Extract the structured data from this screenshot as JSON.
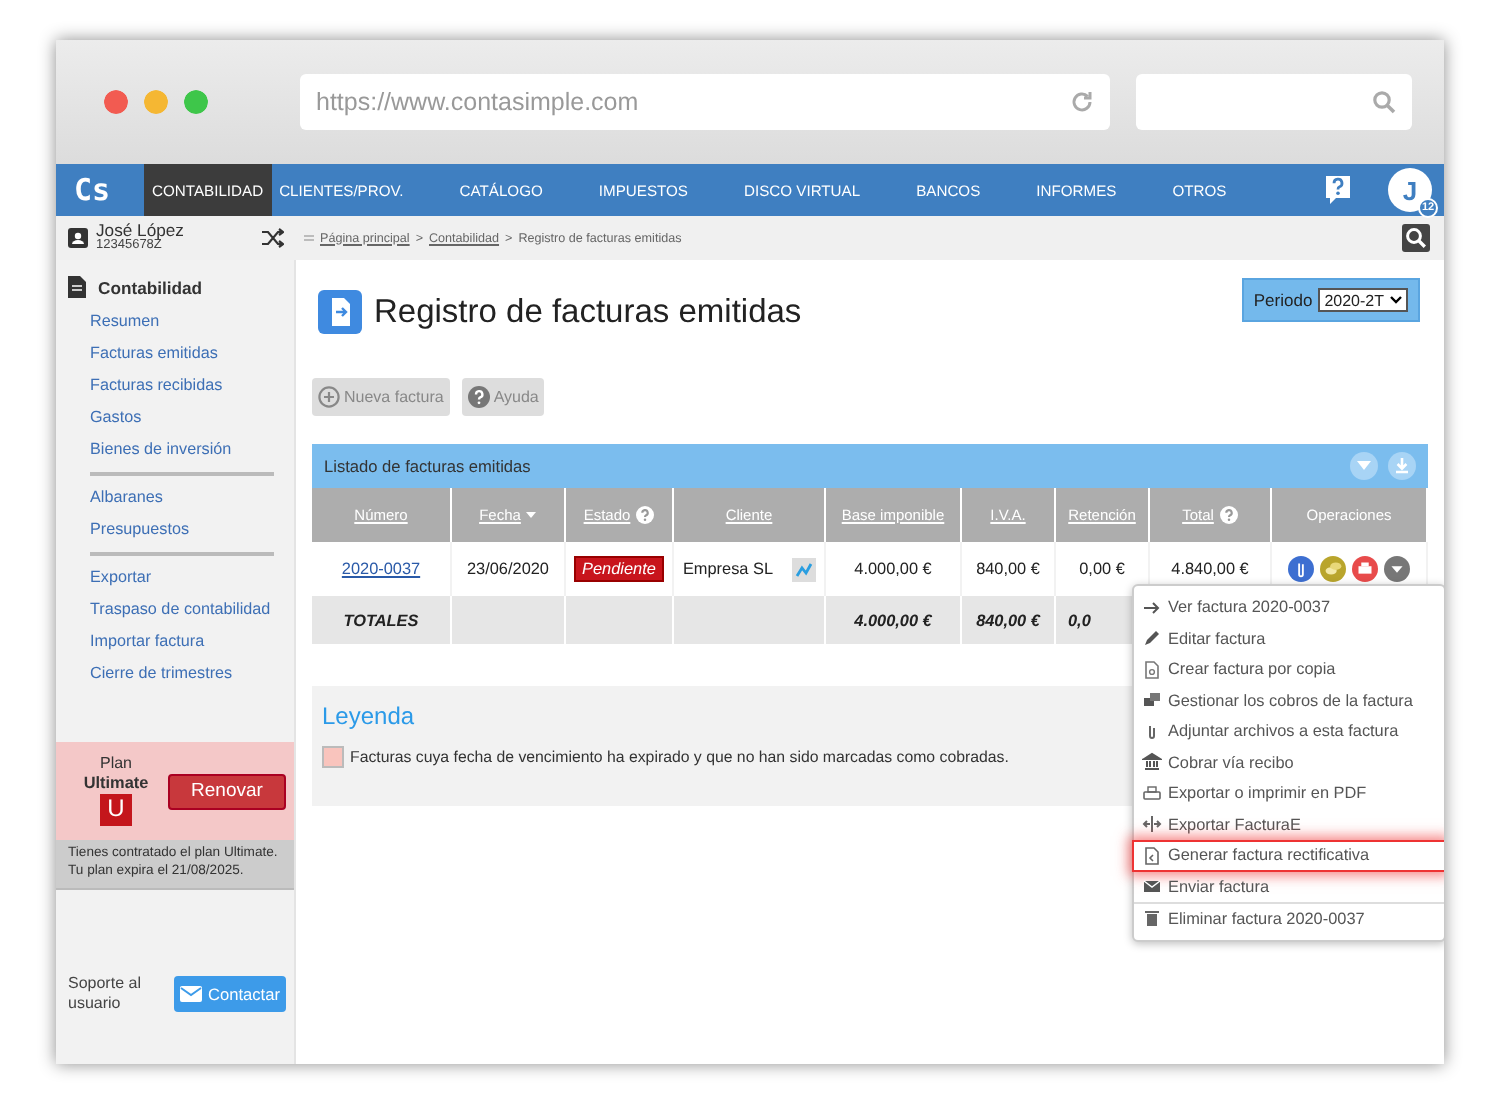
{
  "browser": {
    "url": "https://www.contasimple.com"
  },
  "nav": {
    "logo": "Cs",
    "items": [
      {
        "label": "CONTABILIDAD",
        "selected": true
      },
      {
        "label": "CLIENTES/PROV.",
        "selected": false
      },
      {
        "label": "CATÁLOGO",
        "selected": false
      },
      {
        "label": "IMPUESTOS",
        "selected": false
      },
      {
        "label": "DISCO VIRTUAL",
        "selected": false
      },
      {
        "label": "BANCOS",
        "selected": false
      },
      {
        "label": "INFORMES",
        "selected": false
      },
      {
        "label": "OTROS",
        "selected": false
      }
    ],
    "avatar": {
      "initial": "J",
      "badge": "12"
    }
  },
  "user": {
    "name": "José López",
    "id": "12345678Z"
  },
  "breadcrumb": {
    "links": [
      "Página principal",
      "Contabilidad"
    ],
    "separator": ">",
    "current": "Registro de facturas emitidas"
  },
  "sidebar": {
    "section": "Contabilidad",
    "groups": [
      [
        "Resumen",
        "Facturas emitidas",
        "Facturas recibidas",
        "Gastos",
        "Bienes de inversión"
      ],
      [
        "Albaranes",
        "Presupuestos"
      ],
      [
        "Exportar",
        "Traspaso de contabilidad",
        "Importar factura",
        "Cierre de trimestres"
      ]
    ]
  },
  "plan": {
    "label": "Plan",
    "name": "Ultimate",
    "badge": "U",
    "button": "Renovar",
    "note": "Tienes contratado el plan Ultimate. Tu plan expira el 21/08/2025."
  },
  "support": {
    "text": "Soporte al usuario",
    "button": "Contactar"
  },
  "page": {
    "title": "Registro de facturas emitidas",
    "period_label": "Periodo",
    "period_value": "2020-2T",
    "buttons": [
      "Nueva factura",
      "Ayuda"
    ]
  },
  "table": {
    "title": "Listado de facturas emitidas",
    "columns": [
      {
        "label": "Número",
        "help": false,
        "sort": false
      },
      {
        "label": "Fecha",
        "help": false,
        "sort": true
      },
      {
        "label": "Estado",
        "help": true,
        "sort": false
      },
      {
        "label": "Cliente",
        "help": false,
        "sort": false
      },
      {
        "label": "Base imponible",
        "help": false,
        "sort": false
      },
      {
        "label": "I.V.A.",
        "help": false,
        "sort": false
      },
      {
        "label": "Retención",
        "help": false,
        "sort": false
      },
      {
        "label": "Total",
        "help": true,
        "sort": false
      },
      {
        "label": "Operaciones",
        "help": false,
        "sort": false
      }
    ],
    "rows": [
      {
        "number": "2020-0037",
        "date": "23/06/2020",
        "status": "Pendiente",
        "client": "Empresa SL",
        "base": "4.000,00 €",
        "iva": "840,00 €",
        "retention": "0,00 €",
        "total": "4.840,00 €"
      }
    ],
    "totals": {
      "label": "TOTALES",
      "base": "4.000,00 €",
      "iva": "840,00 €",
      "retention": "0,0"
    }
  },
  "menu": {
    "items": [
      {
        "label": "Ver factura 2020-0037",
        "selected": false,
        "divider_before": false
      },
      {
        "label": "Editar factura",
        "selected": false,
        "divider_before": false
      },
      {
        "label": "Crear factura por copia",
        "selected": false,
        "divider_before": false
      },
      {
        "label": "Gestionar los cobros de la factura",
        "selected": false,
        "divider_before": false
      },
      {
        "label": "Adjuntar archivos a esta factura",
        "selected": false,
        "divider_before": false
      },
      {
        "label": "Cobrar vía recibo",
        "selected": false,
        "divider_before": false
      },
      {
        "label": "Exportar o imprimir en PDF",
        "selected": false,
        "divider_before": false
      },
      {
        "label": "Exportar FacturaE",
        "selected": false,
        "divider_before": false
      },
      {
        "label": "Generar factura rectificativa",
        "selected": true,
        "divider_before": false
      },
      {
        "label": "Enviar factura",
        "selected": false,
        "divider_before": false
      },
      {
        "label": "Eliminar factura 2020-0037",
        "selected": false,
        "divider_before": true
      }
    ]
  },
  "legend": {
    "title": "Leyenda",
    "items": [
      {
        "text": "Facturas cuya fecha de vencimiento ha expirado y que no han sido marcadas como cobradas.",
        "color": "#f9c4bd"
      }
    ]
  }
}
